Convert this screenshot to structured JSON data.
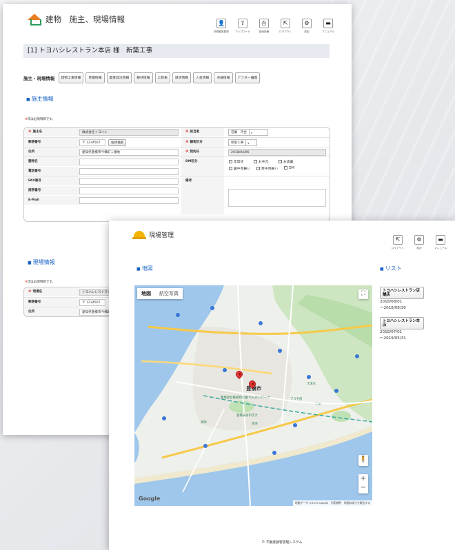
{
  "colors": {
    "accent": "#1a63c8",
    "required": "#d22222",
    "pin": "#e53935",
    "helmet": "#f4b400"
  },
  "win1": {
    "title": "建物　施主、現場情報",
    "toolbar": [
      {
        "icon": "person-icon",
        "glyph": "👤",
        "label": "新規顧客登録"
      },
      {
        "icon": "upload-icon",
        "glyph": "⇪",
        "label": "アップロード"
      },
      {
        "icon": "print-icon",
        "glyph": "⎙",
        "label": "接続設備"
      },
      {
        "icon": "logout-icon",
        "glyph": "⇱",
        "label": "ログアウト"
      },
      {
        "icon": "gear-icon",
        "glyph": "⚙",
        "label": "設定"
      },
      {
        "icon": "manual-icon",
        "glyph": "▬",
        "label": "マニュアル"
      }
    ],
    "project": "[1] トヨハシレストラン本店 様　新築工事",
    "tabs_current": "施主・現場情報",
    "tabs": [
      "建物工事情報",
      "見積情報",
      "業者発注情報",
      "部材情報",
      "工程表",
      "請求情報",
      "入金情報",
      "点検情報",
      "アフター履歴"
    ],
    "owner_section": "施主情報",
    "required_note_mark": "※",
    "required_note": "印は必須項目です。",
    "owner_form": {
      "owner_name_label": "施主名",
      "owner_name": "株式会社トヨハシ",
      "staff_label": "担当者",
      "staff": "営業　河合",
      "postal_label": "郵便番号",
      "postal_mark": "〒",
      "postal": "1234567",
      "address_search": "住所検索",
      "customer_type_label": "顧客区分",
      "customer_type": "新築工事",
      "address_label": "住所",
      "address": "愛知県豊橋市今橋町１番地",
      "contract_label": "契約日",
      "contract_date": "2018/04/06",
      "building_label": "建物名",
      "dm_label": "DM区分",
      "dm_options": [
        "年賀状",
        "お中元",
        "お歳暮",
        "暑中見舞い",
        "寒中見舞い",
        "DM"
      ],
      "phone_label": "電話番号",
      "fax_label": "FAX番号",
      "note_label": "備考",
      "mobile_label": "携帯番号",
      "email_label": "E-Mail"
    },
    "site_section": "現場情報",
    "site_form": {
      "site_name_label": "現場名",
      "site_name": "トヨハシレストラン本店",
      "postal_label": "郵便番号",
      "postal_mark": "〒",
      "postal": "1234567",
      "address_label": "住所",
      "address": "愛知県豊橋市今橋町１番地"
    }
  },
  "win2": {
    "title": "現場管理",
    "toolbar": [
      {
        "icon": "logout-icon",
        "glyph": "⇱",
        "label": "ログアウト"
      },
      {
        "icon": "gear-icon",
        "glyph": "⚙",
        "label": "設定"
      },
      {
        "icon": "manual-icon",
        "glyph": "▬",
        "label": "マニュアル"
      }
    ],
    "map_section": "地図",
    "list_section": "リスト",
    "map_tabs": [
      "地図",
      "航空写真"
    ],
    "city_label": "豊橋市",
    "map_places": [
      "豊橋総合動植物公園 のんほいパーク",
      "アスモ前",
      "二川",
      "大清水",
      "高師",
      "南栄",
      "豊橋技術科学大"
    ],
    "google": "Google",
    "attribution": "地図データ ©2019 Google　利用規約　地図の誤りを報告する",
    "list": [
      {
        "name": "トヨハシレストラン店舗店",
        "start": "2018/08/01",
        "end": "～2018/08/30"
      },
      {
        "name": "トヨハシレストラン本店",
        "start": "2018/07/01",
        "end": "～2019/05/31"
      }
    ],
    "footer": "© 不動産顧客管理システム"
  }
}
